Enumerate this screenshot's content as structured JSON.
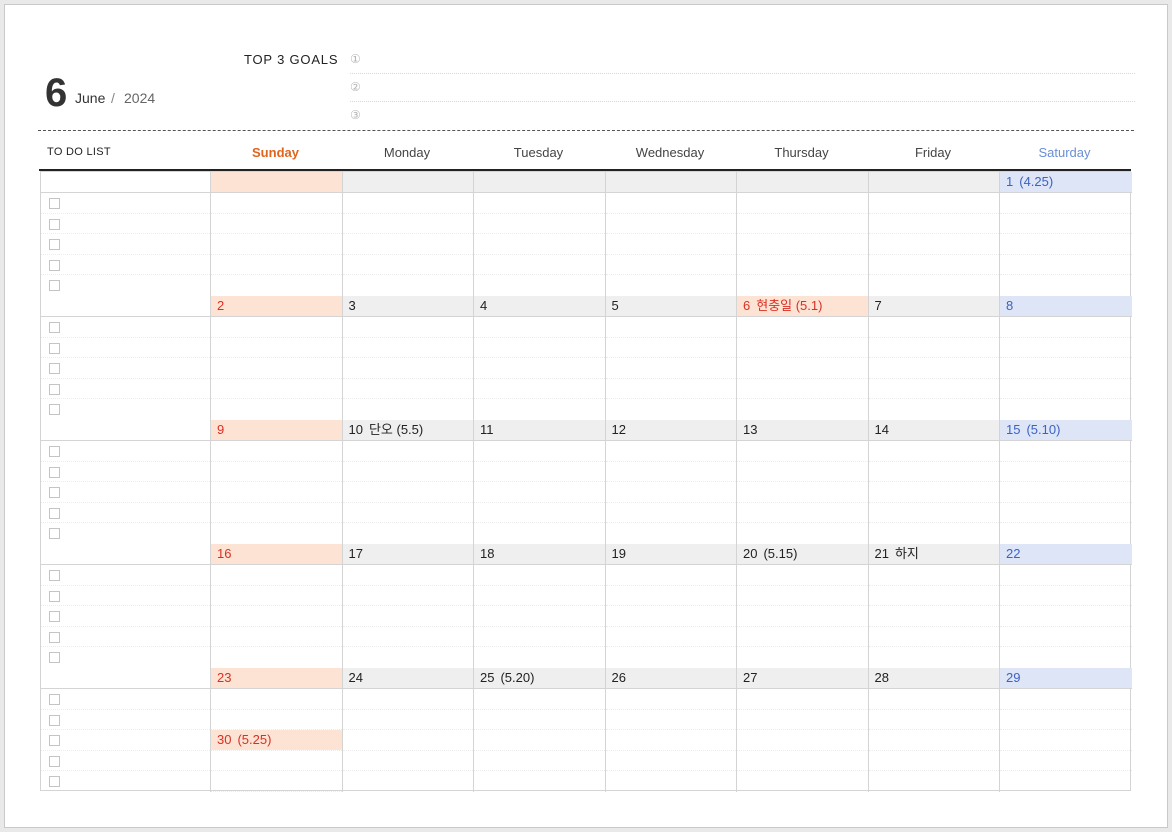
{
  "header": {
    "month_number": "6",
    "month_name": "June",
    "separator": "/",
    "year": "2024",
    "goals_label": "TOP 3 GOALS",
    "goal_markers": [
      "①",
      "②",
      "③"
    ]
  },
  "columns": {
    "todo_title": "TO DO LIST",
    "days": [
      "Sunday",
      "Monday",
      "Tuesday",
      "Wednesday",
      "Thursday",
      "Friday",
      "Saturday"
    ]
  },
  "colors": {
    "sunday_header": "#e0641e",
    "saturday_header": "#6b8ed6",
    "sunday_bg": "#fde3d3",
    "saturday_bg": "#dde5f7",
    "holiday_text": "#d93025"
  },
  "weeks": [
    {
      "cells": [
        {
          "num": "",
          "extra": ""
        },
        {
          "num": "",
          "extra": ""
        },
        {
          "num": "",
          "extra": ""
        },
        {
          "num": "",
          "extra": ""
        },
        {
          "num": "",
          "extra": ""
        },
        {
          "num": "",
          "extra": ""
        },
        {
          "num": "1",
          "extra": "(4.25)"
        }
      ]
    },
    {
      "cells": [
        {
          "num": "2",
          "extra": ""
        },
        {
          "num": "3",
          "extra": ""
        },
        {
          "num": "4",
          "extra": ""
        },
        {
          "num": "5",
          "extra": ""
        },
        {
          "num": "6",
          "extra": "현충일  (5.1)"
        },
        {
          "num": "7",
          "extra": ""
        },
        {
          "num": "8",
          "extra": ""
        }
      ]
    },
    {
      "cells": [
        {
          "num": "9",
          "extra": ""
        },
        {
          "num": "10",
          "extra": "단오  (5.5)"
        },
        {
          "num": "11",
          "extra": ""
        },
        {
          "num": "12",
          "extra": ""
        },
        {
          "num": "13",
          "extra": ""
        },
        {
          "num": "14",
          "extra": ""
        },
        {
          "num": "15",
          "extra": "(5.10)"
        }
      ]
    },
    {
      "cells": [
        {
          "num": "16",
          "extra": ""
        },
        {
          "num": "17",
          "extra": ""
        },
        {
          "num": "18",
          "extra": ""
        },
        {
          "num": "19",
          "extra": ""
        },
        {
          "num": "20",
          "extra": "(5.15)"
        },
        {
          "num": "21",
          "extra": "하지"
        },
        {
          "num": "22",
          "extra": ""
        }
      ]
    },
    {
      "cells": [
        {
          "num": "23",
          "extra": ""
        },
        {
          "num": "24",
          "extra": ""
        },
        {
          "num": "25",
          "extra": "(5.20)"
        },
        {
          "num": "26",
          "extra": ""
        },
        {
          "num": "27",
          "extra": ""
        },
        {
          "num": "28",
          "extra": ""
        },
        {
          "num": "29",
          "extra": ""
        }
      ]
    }
  ],
  "extra_day": {
    "num": "30",
    "extra": "(5.25)"
  }
}
